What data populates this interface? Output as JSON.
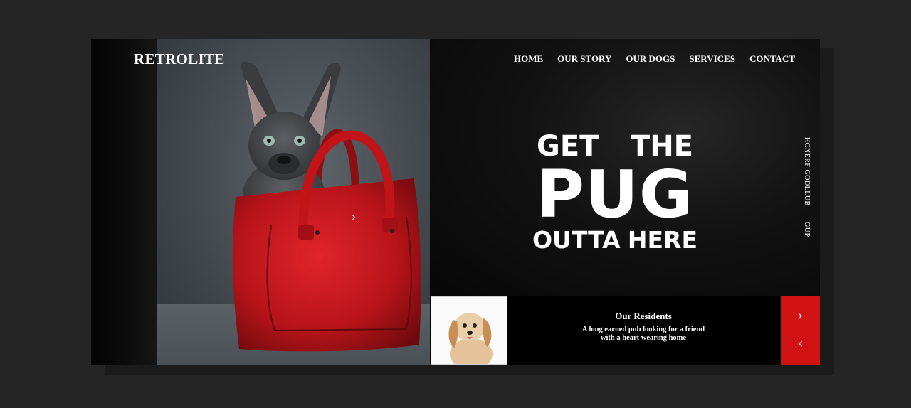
{
  "brand": {
    "name": "RETROLITE"
  },
  "nav": {
    "items": [
      {
        "label": "HOME"
      },
      {
        "label": "OUR STORY"
      },
      {
        "label": "OUR DOGS"
      },
      {
        "label": "SERVICES"
      },
      {
        "label": "CONTACT"
      }
    ]
  },
  "hero": {
    "line1_word1": "GET",
    "line1_word2": "THE",
    "line2": "PUG",
    "line3_word1": "OUTTA",
    "line3_word2": "HERE",
    "vertical_text_1": "HCNERF GODLLUB",
    "vertical_text_2": "GUP",
    "photo_arrow_icon": "chevron-right-icon"
  },
  "residents": {
    "title": "Our Residents",
    "text_line1": "A long earned pub looking for a friend",
    "text_line2": "with a heart wearing home",
    "next_icon": "chevron-right-icon",
    "prev_icon": "chevron-left-icon"
  },
  "colors": {
    "background": "#252525",
    "card": "#0a0a0a",
    "accent_red": "#d01212",
    "bag_red": "#c8161b",
    "text": "#ffffff"
  }
}
